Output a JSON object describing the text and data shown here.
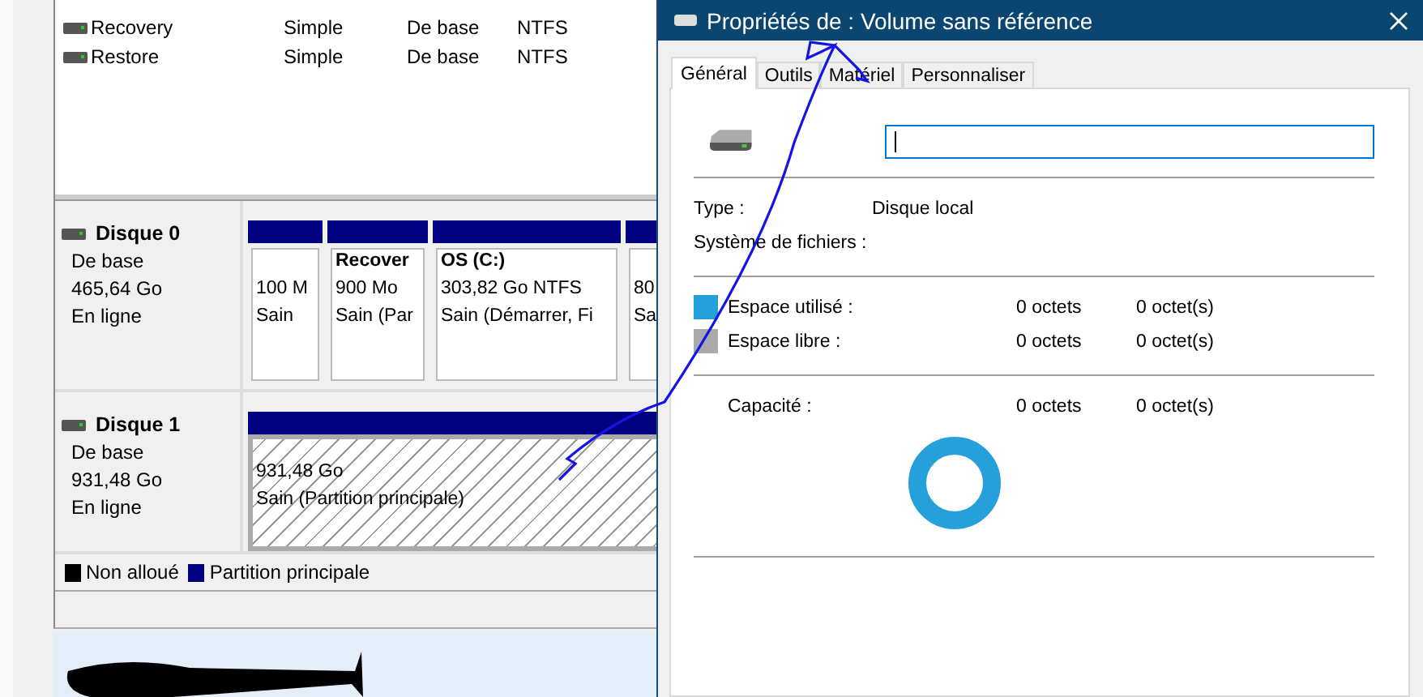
{
  "volume_list": {
    "rows": [
      {
        "name": "Recovery",
        "layout": "Simple",
        "type": "De base",
        "file_system": "NTFS"
      },
      {
        "name": "Restore",
        "layout": "Simple",
        "type": "De base",
        "file_system": "NTFS"
      }
    ]
  },
  "disks": [
    {
      "name": "Disque 0",
      "type": "De base",
      "size": "465,64 Go",
      "status": "En ligne",
      "partitions": [
        {
          "size": "100 M",
          "health": "Sain",
          "selected": false
        },
        {
          "title": "Recover",
          "size": "900 Mo",
          "health": "Sain (Par",
          "selected": false
        },
        {
          "title": "OS  (C:)",
          "size": "303,82 Go NTFS",
          "health": "Sain (Démarrer, Fi",
          "selected": false
        },
        {
          "size": "80",
          "health": "Sa",
          "selected": false
        }
      ]
    },
    {
      "name": "Disque 1",
      "type": "De base",
      "size": "931,48 Go",
      "status": "En ligne",
      "partitions": [
        {
          "size": "931,48 Go",
          "health": "Sain (Partition principale)",
          "selected": true
        }
      ]
    }
  ],
  "legend": [
    {
      "label": "Non alloué",
      "color": "#000000"
    },
    {
      "label": "Partition principale",
      "color": "#000080"
    }
  ],
  "dialog": {
    "title": "Propriétés de : Volume sans référence",
    "tabs": [
      {
        "label": "Général",
        "selected": true
      },
      {
        "label": "Outils",
        "selected": false
      },
      {
        "label": "Matériel",
        "selected": false
      },
      {
        "label": "Personnaliser",
        "selected": false
      }
    ],
    "type_label": "Type :",
    "type_value": "Disque local",
    "fs_label": "Système de fichiers :",
    "space": [
      {
        "label": "Espace utilisé :",
        "bytes": "0 octets",
        "short": "0 octet(s)",
        "color": "#26a0da"
      },
      {
        "label": "Espace libre :",
        "bytes": "0 octets",
        "short": "0 octet(s)",
        "color": "#aaaaaa"
      }
    ],
    "capacity": {
      "label": "Capacité :",
      "bytes": "0 octets",
      "short": "0 octet(s)"
    }
  }
}
